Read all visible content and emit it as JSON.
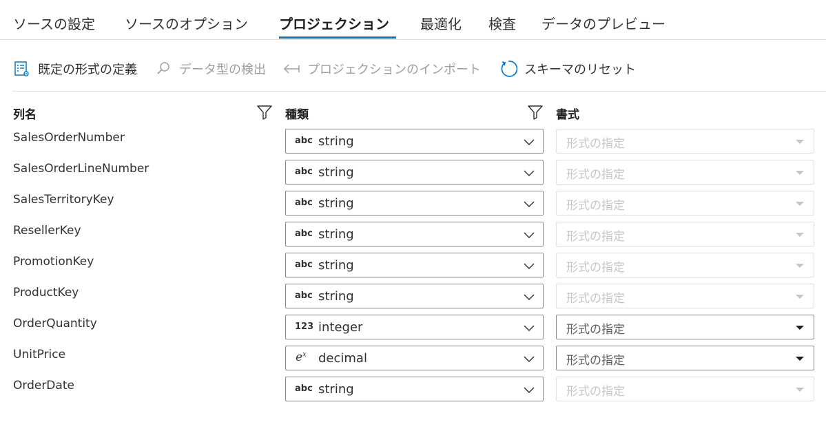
{
  "tabs": [
    {
      "label": "ソースの設定"
    },
    {
      "label": "ソースのオプション"
    },
    {
      "label": "プロジェクション"
    },
    {
      "label": "最適化"
    },
    {
      "label": "検査"
    },
    {
      "label": "データのプレビュー"
    }
  ],
  "toolbar": {
    "define_format": "既定の形式の定義",
    "detect_types": "データ型の検出",
    "import_projection": "プロジェクションのインポート",
    "reset_schema": "スキーマのリセット"
  },
  "columns": {
    "name": "列名",
    "type": "種類",
    "format": "書式"
  },
  "rows": [
    {
      "name": "SalesOrderNumber",
      "type_icon": "abc",
      "type": "string",
      "format": "形式の指定"
    },
    {
      "name": "SalesOrderLineNumber",
      "type_icon": "abc",
      "type": "string",
      "format": "形式の指定"
    },
    {
      "name": "SalesTerritoryKey",
      "type_icon": "abc",
      "type": "string",
      "format": "形式の指定"
    },
    {
      "name": "ResellerKey",
      "type_icon": "abc",
      "type": "string",
      "format": "形式の指定"
    },
    {
      "name": "PromotionKey",
      "type_icon": "abc",
      "type": "string",
      "format": "形式の指定"
    },
    {
      "name": "ProductKey",
      "type_icon": "abc",
      "type": "string",
      "format": "形式の指定"
    },
    {
      "name": "OrderQuantity",
      "type_icon": "123",
      "type": "integer",
      "format": "形式の指定"
    },
    {
      "name": "UnitPrice",
      "type_icon": "ex",
      "type": "decimal",
      "format": "形式の指定"
    },
    {
      "name": "OrderDate",
      "type_icon": "abc",
      "type": "string",
      "format": "形式の指定"
    }
  ],
  "colors": {
    "accent": "#0078d4",
    "disabled_text": "#a19f9d"
  }
}
